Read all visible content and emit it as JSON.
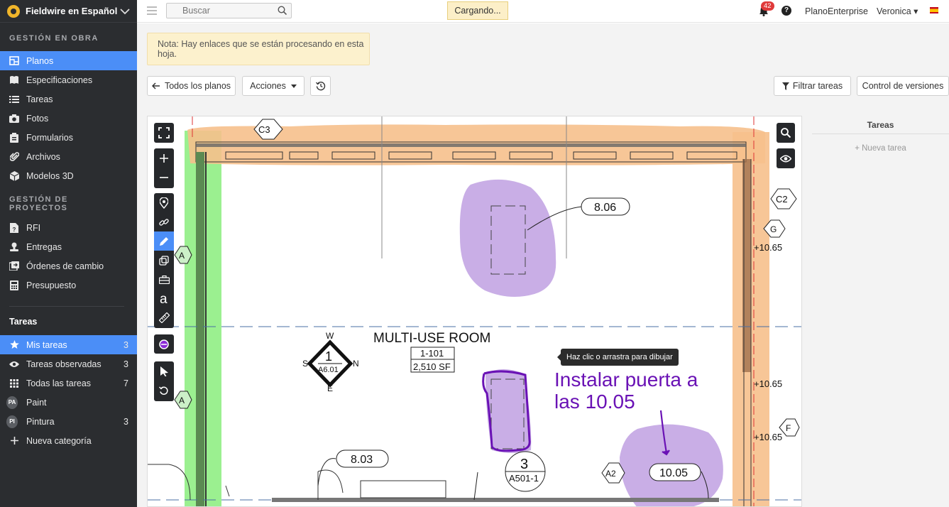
{
  "sidebar": {
    "project_name": "Fieldwire en Español",
    "sections": {
      "obra": "GESTIÓN EN OBRA",
      "proyectos": "GESTIÓN DE PROYECTOS",
      "tareas": "Tareas"
    },
    "obra_items": [
      {
        "label": "Planos",
        "icon": "blueprint-icon"
      },
      {
        "label": "Especificaciones",
        "icon": "book-icon"
      },
      {
        "label": "Tareas",
        "icon": "list-icon"
      },
      {
        "label": "Fotos",
        "icon": "camera-icon"
      },
      {
        "label": "Formularios",
        "icon": "clipboard-icon"
      },
      {
        "label": "Archivos",
        "icon": "paperclip-icon"
      },
      {
        "label": "Modelos 3D",
        "icon": "cube-icon"
      }
    ],
    "proyectos_items": [
      {
        "label": "RFI",
        "icon": "rfi-icon"
      },
      {
        "label": "Entregas",
        "icon": "stamp-icon"
      },
      {
        "label": "Órdenes de cambio",
        "icon": "change-order-icon"
      },
      {
        "label": "Presupuesto",
        "icon": "calculator-icon"
      }
    ],
    "tareas_items": [
      {
        "label": "Mis tareas",
        "count": "3",
        "icon": "star-icon"
      },
      {
        "label": "Tareas observadas",
        "count": "3",
        "icon": "eye-icon"
      },
      {
        "label": "Todas las tareas",
        "count": "7",
        "icon": "grid-icon"
      },
      {
        "label": "Paint",
        "count": "",
        "avatar": "PA"
      },
      {
        "label": "Pintura",
        "count": "3",
        "avatar": "PI"
      },
      {
        "label": "Nueva categoría",
        "count": "",
        "icon": "plus-icon"
      }
    ]
  },
  "topbar": {
    "search_placeholder": "Buscar",
    "loading": "Cargando...",
    "notifications": "42",
    "help": "?",
    "organization": "PlanoEnterprise",
    "user": "Veronica ▾"
  },
  "notice": "Nota: Hay enlaces que se están procesando en esta hoja.",
  "toolbar": {
    "all_plans": "Todos los planos",
    "actions": "Acciones",
    "filter": "Filtrar tareas",
    "versions": "Control de versiones"
  },
  "plan": {
    "room_name": "MULTI-USE ROOM",
    "room_number": "1-101",
    "room_area": "2,510 SF",
    "tooltip": "Haz clic o arrastra para dibujar",
    "annotation_line1": "Instalar puerta a",
    "annotation_line2": "las 10.05",
    "tags": {
      "c3": "C3",
      "c2": "C2",
      "g": "G",
      "f": "F",
      "a2": "A2",
      "a_top": "A",
      "a_bottom": "A",
      "d806": "8.06",
      "d803": "8.03",
      "d1005": "10.05",
      "elev1": "+10.65",
      "elev2": "+10.65",
      "elev3": "+10.65",
      "sec_num": "3",
      "sec_ref": "A501-1",
      "compass_num": "1",
      "compass_ref": "A6.01",
      "north": "N",
      "south": "S",
      "east": "E",
      "west": "W"
    },
    "colors": {
      "green": "#90ee84",
      "orange": "#f6c08c",
      "purple": "#c9aee6",
      "ink": "#6a12b5"
    }
  },
  "tasks_panel": {
    "title": "Tareas",
    "new_task": "+ Nueva tarea"
  }
}
